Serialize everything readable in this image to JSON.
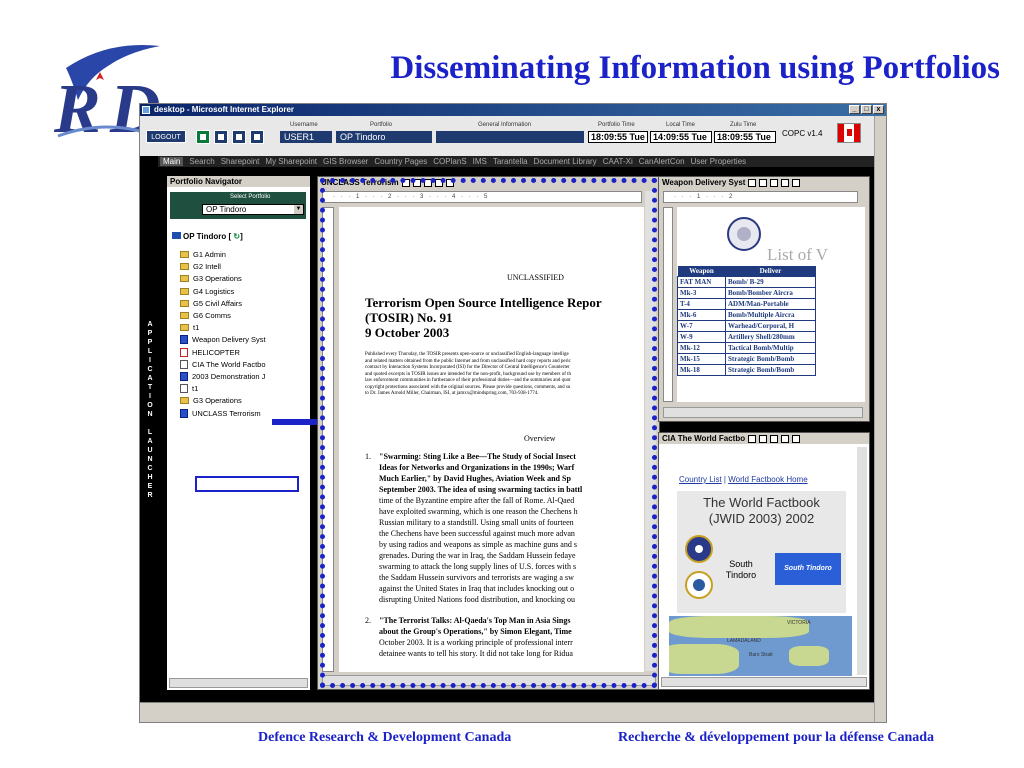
{
  "slide": {
    "title": "Disseminating Information using Portfolios",
    "footer_left": "Defence Research & Development Canada",
    "footer_right": "Recherche & développement pour la défense Canada",
    "accent_color": "#1b22c8"
  },
  "browser": {
    "title": "desktop - Microsoft Internet Explorer",
    "ctrl_min": "_",
    "ctrl_max": "□",
    "ctrl_close": "x"
  },
  "header": {
    "logout": "LOGOUT",
    "username_label": "Username",
    "username": "USER1",
    "portfolio_label": "Portfolio",
    "portfolio": "OP Tindoro",
    "general_label": "General Information",
    "portfolio_time_label": "Portfolio Time",
    "portfolio_time": "18:09:55 Tue",
    "local_time_label": "Local Time",
    "local_time": "14:09:55 Tue",
    "zulu_time_label": "Zulu Time",
    "zulu_time": "18:09:55 Tue",
    "app_version": "COPC v1.4"
  },
  "nav": {
    "tabs": [
      "Main",
      "Search",
      "Sharepoint",
      "My Sharepoint",
      "GIS Browser",
      "Country Pages",
      "COPlanS",
      "IMS",
      "Tarantella",
      "Document Library",
      "CAAT-Xi",
      "CanAlertCon",
      "User Properties"
    ],
    "active": "Main"
  },
  "launcher": {
    "letters": [
      "A",
      "P",
      "P",
      "L",
      "I",
      "C",
      "A",
      "T",
      "I",
      "O",
      "N",
      "",
      "L",
      "A",
      "U",
      "N",
      "C",
      "H",
      "E",
      "R"
    ]
  },
  "navigator": {
    "title": "Portfolio Navigator",
    "select_label": "Select Portfolio",
    "select_value": "OP Tindoro",
    "root": "OP Tindoro [",
    "root_end": "]",
    "items": [
      {
        "label": "G1 Admin",
        "icon": "folder-icon"
      },
      {
        "label": "G2 Intell",
        "icon": "folder-icon"
      },
      {
        "label": "G3 Operations",
        "icon": "folder-icon"
      },
      {
        "label": "G4 Logistics",
        "icon": "folder-icon"
      },
      {
        "label": "G5 Civil Affairs",
        "icon": "folder-icon"
      },
      {
        "label": "G6 Comms",
        "icon": "folder-icon"
      },
      {
        "label": "t1",
        "icon": "folder-icon"
      },
      {
        "label": "Weapon Delivery Syst",
        "icon": "word-doc-icon"
      },
      {
        "label": "HELICOPTER",
        "icon": "pdf-icon"
      },
      {
        "label": "CIA The World Factbo",
        "icon": "page-icon"
      },
      {
        "label": "2003 Demonstration J",
        "icon": "word-doc-icon"
      },
      {
        "label": "t1",
        "icon": "page-icon"
      },
      {
        "label": "G3 Operations",
        "icon": "folder-icon"
      },
      {
        "label": "UNCLASS Terrorism",
        "icon": "word-doc-icon"
      }
    ]
  },
  "doc": {
    "window_title": "UNCLASS Terrorism",
    "ruler": "· · · 1 · · · 2 · · · 3 · · · 4 · · · 5",
    "classification": "UNCLASSIFIED",
    "title_line1": "Terrorism Open Source Intelligence Repor",
    "title_line2": "(TOSIR) No. 91",
    "title_line3": "9 October 2003",
    "intro_lines": [
      "Published every Thursday, the TOSIR presents open-source or unclassified English-language intellige",
      "and related matters obtained from the public Internet and from unclassified hard copy reports and peric",
      "contract by Interaction Systems Incorporated (ISI) for the Director of Central Intelligence's Counterter",
      "and quoted excerpts in TOSIR issues are intended for the non-profit, background use by members of th",
      "law enforcement communities in furtherance of their professional duties—and the summaries and quot",
      "copyright protections associated with the original sources. Please provide questions, comments, and su",
      "to Dr. James Arnold Miller, Chairman, ISI, at jamxx@mindspring.com, 703-938-1774."
    ],
    "overview": "Overview",
    "item1_num": "1.",
    "item1_lines": [
      "\"Swarming: Sting Like a Bee—The Study of Social Insect",
      "Ideas for Networks and Organizations in the 1990s; Warf",
      "Much Earlier,\" by David Hughes, Aviation Week and Sp",
      "September 2003. The idea of using swarming tactics in battl",
      "time of the Byzantine empire after the fall of Rome. Al-Qaed",
      "have exploited swarming, which is one reason the Chechens h",
      "Russian military to a standstill. Using small units of fourteen",
      "the Chechens have been successful against much more advan",
      "by using radios and weapons as simple as machine guns and s",
      "grenades. During the war in Iraq, the Saddam Hussein fedaye",
      "swarming to attack the long supply lines of U.S. forces with s",
      "the Saddam Hussein survivors and terrorists are waging a sw",
      "against the United States in Iraq that includes knocking out o",
      "disrupting United Nations food distribution, and knocking ou"
    ],
    "item2_num": "2.",
    "item2_lines": [
      "\"The Terrorist Talks: Al-Qaeda's Top Man in Asia Sings",
      "about the Group's Operations,\" by Simon Elegant, Time",
      "October 2003. It is a working principle of professional interr",
      "detainee wants to tell his story. It did not take long for Ridua"
    ]
  },
  "weapons": {
    "window_title": "Weapon Delivery Syst",
    "ruler": "· · · 1 · · · 2",
    "list_title": "List of V",
    "col1": "Weapon",
    "col2": "Deliver",
    "rows": [
      [
        "FAT MAN",
        "Bomb/ B-29"
      ],
      [
        "Mk-3",
        "Bomb/Bomber Aircra"
      ],
      [
        "T-4",
        "ADM/Man-Portable"
      ],
      [
        "Mk-6",
        "Bomb/Multiple Aircra"
      ],
      [
        "W-7",
        "Warhead/Corporal, H"
      ],
      [
        "W-9",
        "Artillery Shell/280mm"
      ],
      [
        "Mk-12",
        "Tactical Bomb/Multip"
      ],
      [
        "Mk-15",
        "Strategic Bomb/Bomb"
      ],
      [
        "Mk-18",
        "Strategic Bomb/Bomb"
      ]
    ]
  },
  "factbook": {
    "window_title": "CIA The World Factbo",
    "link1": "Country List",
    "sep": " | ",
    "link2": "World Factbook Home",
    "title": "The World Factbook\n(JWID 2003) 2002",
    "country": "South Tindoro",
    "banner": "South Tindoro",
    "map_labels": [
      "VICTORIA",
      "LAMADALAND",
      "Baro Strait"
    ]
  }
}
